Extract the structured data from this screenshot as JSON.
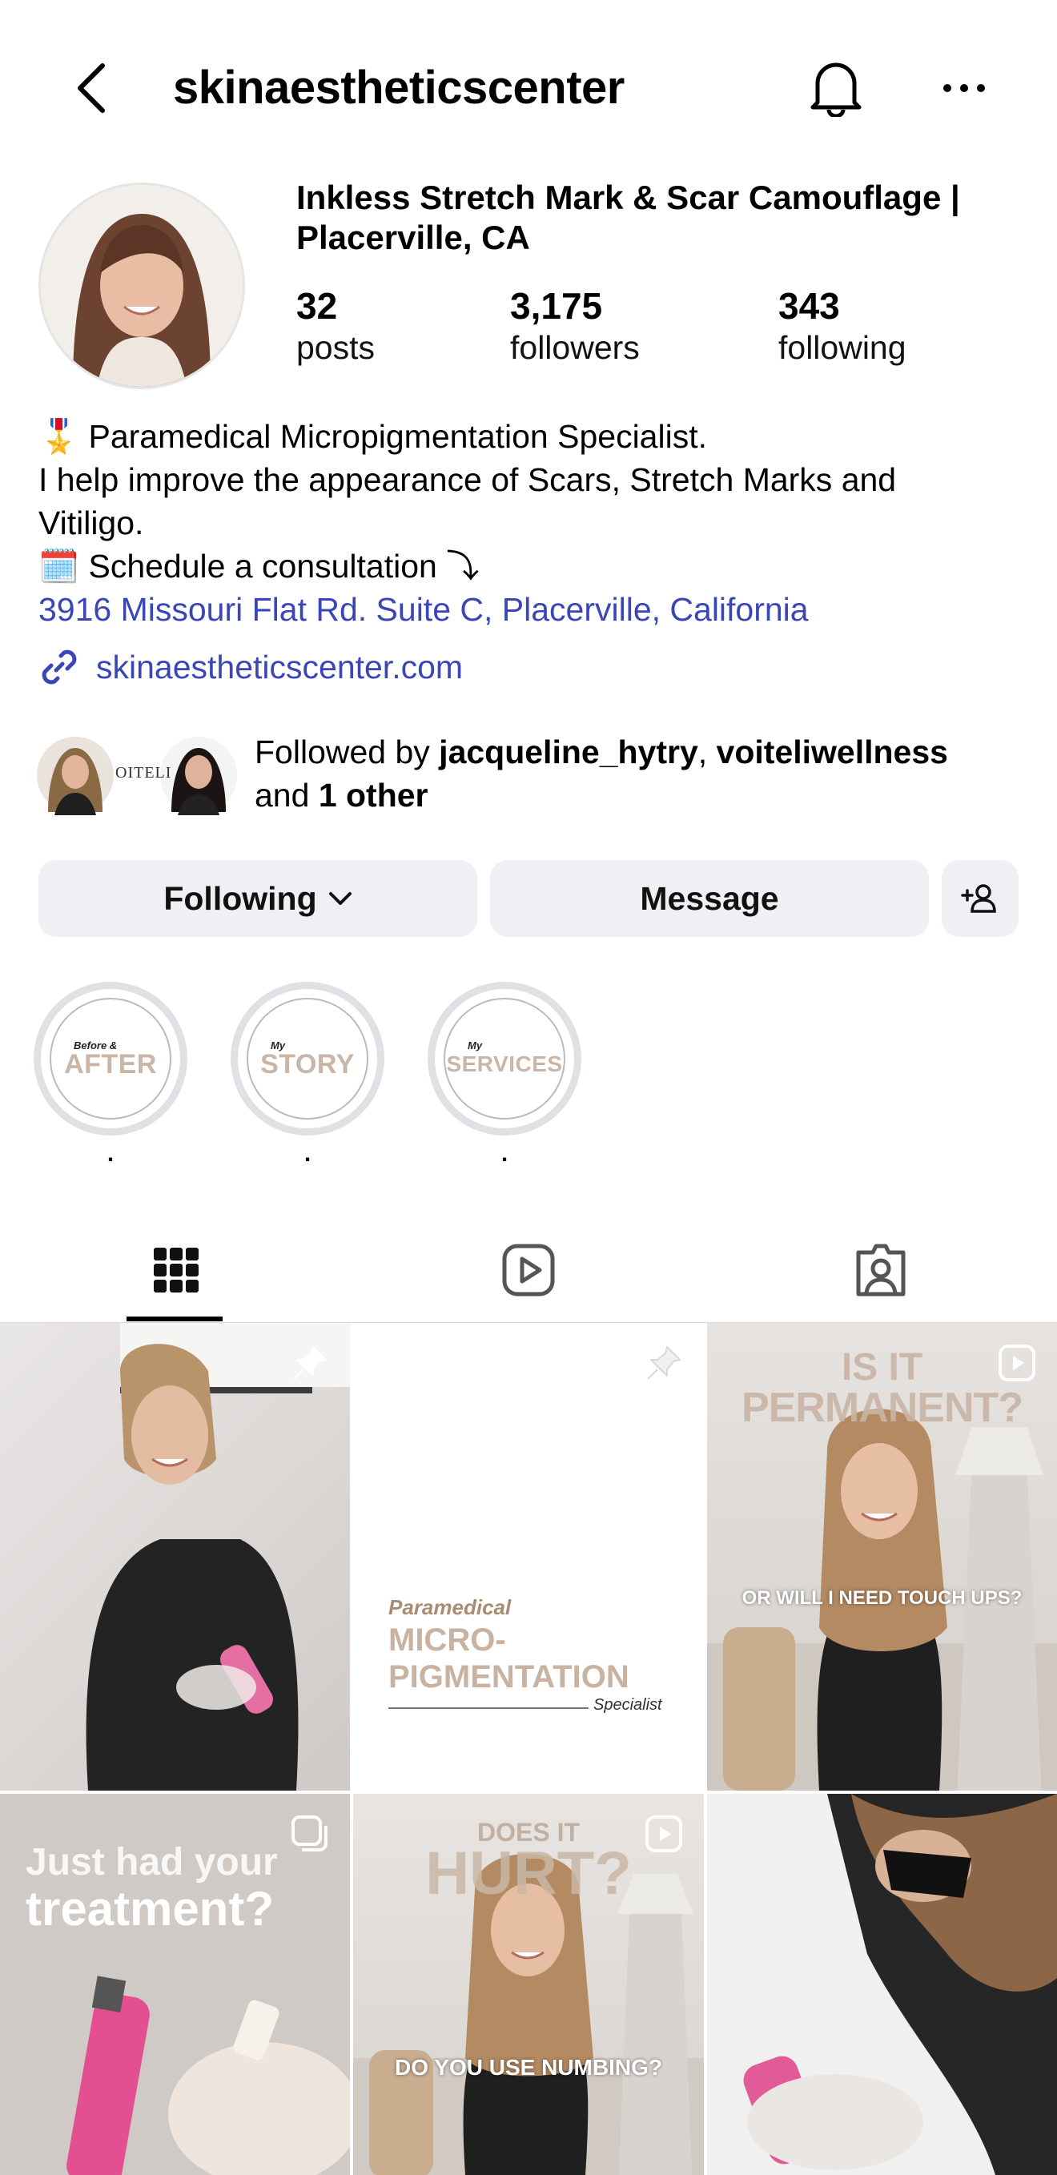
{
  "header": {
    "username": "skinaestheticscenter"
  },
  "profile": {
    "display_name_line1": "Inkless Stretch Mark & Scar Camouflage |",
    "display_name_line2": "Placerville, CA",
    "stats": [
      {
        "value": "32",
        "label": "posts"
      },
      {
        "value": "3,175",
        "label": "followers"
      },
      {
        "value": "343",
        "label": "following"
      }
    ]
  },
  "bio": {
    "line1": "Paramedical Micropigmentation Specialist.",
    "line2": "I help improve the appearance of Scars, Stretch Marks and",
    "line3": "Vitiligo.",
    "line4": "Schedule a consultation",
    "address": "3916 Missouri Flat Rd. Suite C, Placerville, California",
    "website": "skinaestheticscenter.com",
    "emoji1": "🎖️",
    "emoji2": "🗓️",
    "arrow": "⤵"
  },
  "followed_by": {
    "prefix": "Followed by ",
    "user1": "jacqueline_hytry",
    "sep": ", ",
    "user2": "voiteliwellness",
    "and": "and ",
    "others": "1 other",
    "avatar_text": "OITELI"
  },
  "buttons": {
    "following": "Following",
    "message": "Message"
  },
  "highlights": [
    {
      "small": "Before &",
      "big": "AFTER",
      "caption": "."
    },
    {
      "small": "My",
      "big": "STORY",
      "caption": "."
    },
    {
      "small": "My",
      "big": "SERVICES",
      "caption": "."
    }
  ],
  "grid": {
    "post2_line1": "Paramedical",
    "post2_line2": "MICRO-",
    "post2_line3": "PIGMENTATION",
    "post2_line4": "Specialist",
    "post3_top": "IS IT",
    "post3_top2": "PERMANENT?",
    "post3_bottom": "OR WILL I NEED TOUCH UPS?",
    "post4_line1": "Just had your",
    "post4_line2": "treatment?",
    "post5_top": "DOES IT",
    "post5_top2": "HURT?",
    "post5_bottom": "DO YOU USE NUMBING?"
  },
  "colors": {
    "link": "#3a46b8",
    "button_bg": "#eef0f3",
    "beige": "#c9b6a7"
  }
}
